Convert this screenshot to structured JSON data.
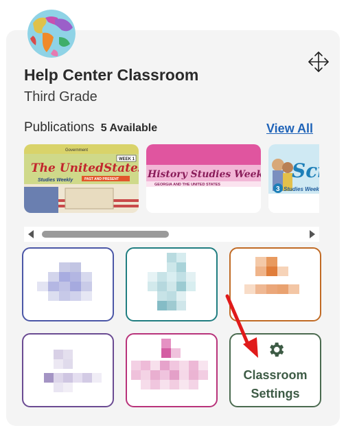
{
  "classroom": {
    "name": "Help Center Classroom",
    "grade": "Third Grade"
  },
  "publications": {
    "label": "Publications",
    "count_text": "5 Available",
    "view_all": "View All",
    "items": [
      {
        "name": "The United States Studies Weekly",
        "banner": "The UnitedStates",
        "brand": "Studies Weekly",
        "week": "WEEK 1",
        "tag": "PAST AND PRESENT",
        "top": "Government"
      },
      {
        "name": "History Studies Weekly",
        "banner": "History Studies Weekly",
        "sub": "GEORGIA AND THE UNITED STATES"
      },
      {
        "name": "Science Studies Weekly",
        "banner": "Sci",
        "brand": "Studies Weekly",
        "num": "3"
      }
    ]
  },
  "tiles": [
    {
      "name": "tile-1",
      "color": "#4a56a6"
    },
    {
      "name": "tile-2",
      "color": "#1f7d80"
    },
    {
      "name": "tile-3",
      "color": "#c06a24"
    },
    {
      "name": "tile-4",
      "color": "#6a4a92"
    },
    {
      "name": "tile-5",
      "color": "#b8327a"
    },
    {
      "name": "classroom-settings",
      "color": "#4a6a4f",
      "label_line1": "Classroom",
      "label_line2": "Settings",
      "icon": "gear-icon"
    }
  ],
  "annotation": {
    "color": "#e01a1a",
    "icon": "arrow-icon"
  }
}
